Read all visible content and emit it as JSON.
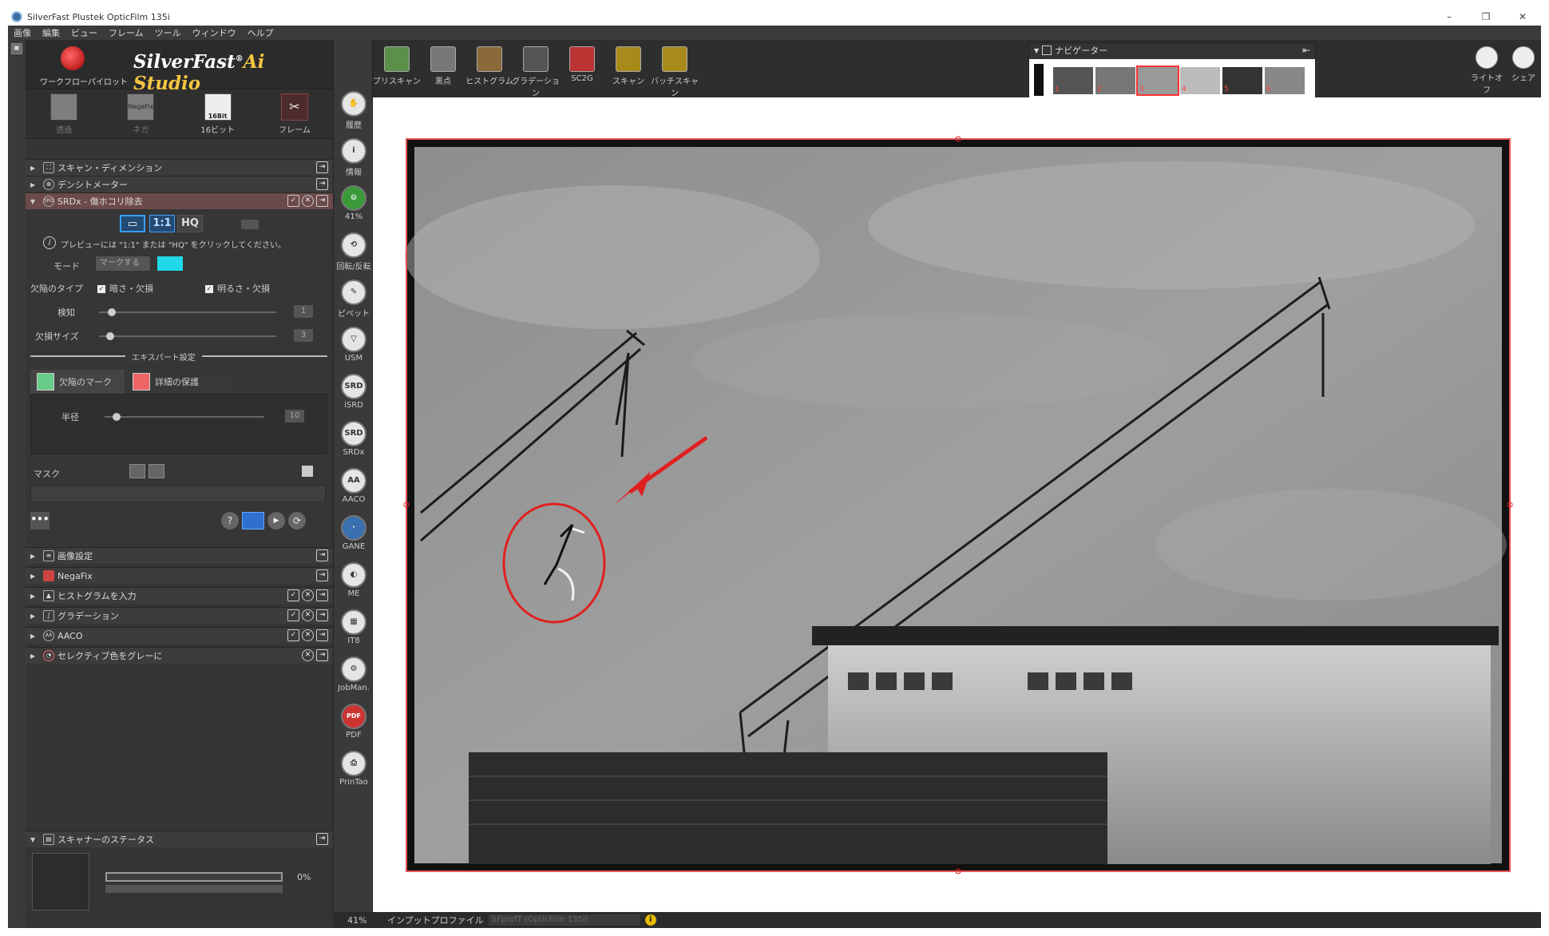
{
  "window": {
    "title": "SilverFast Plustek OpticFilm 135i",
    "controls": [
      "–",
      "❐",
      "✕"
    ]
  },
  "menu": [
    "画像",
    "編集",
    "ビュー",
    "フレーム",
    "ツール",
    "ウィンドウ",
    "ヘルプ"
  ],
  "logo": {
    "workflow_label": "ワークフローパイロット",
    "brand_main": "SilverFast",
    "brand_reg": "®",
    "brand_ai": "Ai Studio"
  },
  "modes": [
    {
      "label": "透過",
      "icon_text": "",
      "dim": true
    },
    {
      "label": "ネガ",
      "icon_text": "NegaFix",
      "dim": true
    },
    {
      "label": "16ビット",
      "icon_text": "16Bit",
      "dim": false
    },
    {
      "label": "フレーム",
      "icon_text": "",
      "dim": false
    }
  ],
  "sections_top": [
    {
      "label": "スキャン・ディメンション"
    },
    {
      "label": "デンシトメーター"
    },
    {
      "label": "SRDx - 傷ホコリ除去"
    }
  ],
  "srdx": {
    "view_buttons": [
      "1:1",
      "HQ"
    ],
    "hint": "プレビューには \"1:1\" または \"HQ\" をクリックしてください。",
    "mode_label": "モード",
    "mode_value": "マークする",
    "mark_color": "#20d8e8",
    "defect_type_label": "欠陥のタイプ",
    "defect_dark": "暗さ・欠損",
    "defect_bright": "明るさ・欠損",
    "detect_label": "検知",
    "detect_value": "1",
    "detect_level": 0.05,
    "size_label": "欠損サイズ",
    "size_value": "3",
    "size_level": 0.04,
    "expert_label": "エキスパート設定",
    "tab_mark": "欠陥のマーク",
    "tab_protect": "詳細の保護",
    "radius_label": "半径",
    "radius_value": "10",
    "radius_level": 0.05,
    "mask_label": "マスク"
  },
  "sections_bottom": [
    {
      "label": "画像設定",
      "badges": ""
    },
    {
      "label": "NegaFix",
      "badges": ""
    },
    {
      "label": "ヒストグラムを入力",
      "badges": "3"
    },
    {
      "label": "グラデーション",
      "badges": "3"
    },
    {
      "label": "AACO",
      "badges": "3"
    },
    {
      "label": "セレクティブ色をグレーに",
      "badges": "2"
    }
  ],
  "scanner_status": {
    "label": "スキャナーのステータス",
    "progress_text": "0%",
    "progress": 0
  },
  "tools": [
    {
      "label": "履歴",
      "glyph": "✋"
    },
    {
      "label": "情報",
      "glyph": "i"
    },
    {
      "label": "41%",
      "glyph": "⊖"
    },
    {
      "label": "回転/反転",
      "glyph": "⟲"
    },
    {
      "label": "ピペット",
      "glyph": "✎"
    },
    {
      "label": "USM",
      "glyph": "▽"
    },
    {
      "label": "iSRD",
      "glyph": "SRD"
    },
    {
      "label": "SRDx",
      "glyph": "SRD"
    },
    {
      "label": "AACO",
      "glyph": "AA"
    },
    {
      "label": "GANE",
      "glyph": "·"
    },
    {
      "label": "ME",
      "glyph": "◐"
    },
    {
      "label": "IT8",
      "glyph": "▦"
    },
    {
      "label": "JobMan.",
      "glyph": "⚙"
    },
    {
      "label": "PDF",
      "glyph": "PDF"
    },
    {
      "label": "PrinTao",
      "glyph": "⎙"
    }
  ],
  "top_tools": [
    {
      "label": "プリスキャン"
    },
    {
      "label": "黒点"
    },
    {
      "label": "ヒストグラム"
    },
    {
      "label": "グラデーション"
    },
    {
      "label": "SC2G"
    },
    {
      "label": "スキャン"
    },
    {
      "label": "バッチスキャン"
    }
  ],
  "right_tools": [
    {
      "label": "ライトオフ"
    },
    {
      "label": "シェア"
    }
  ],
  "navigator": {
    "title": "ナビゲーター",
    "thumbs": [
      "1",
      "2",
      "3",
      "4",
      "5",
      "6"
    ],
    "selected": 3
  },
  "status": {
    "zoom": "41%",
    "profile_label": "インプットプロファイル",
    "profile_value": "SFprofT (OpticFilm 135i)"
  },
  "colors": {
    "accent": "#e02020",
    "panel": "#353535"
  }
}
